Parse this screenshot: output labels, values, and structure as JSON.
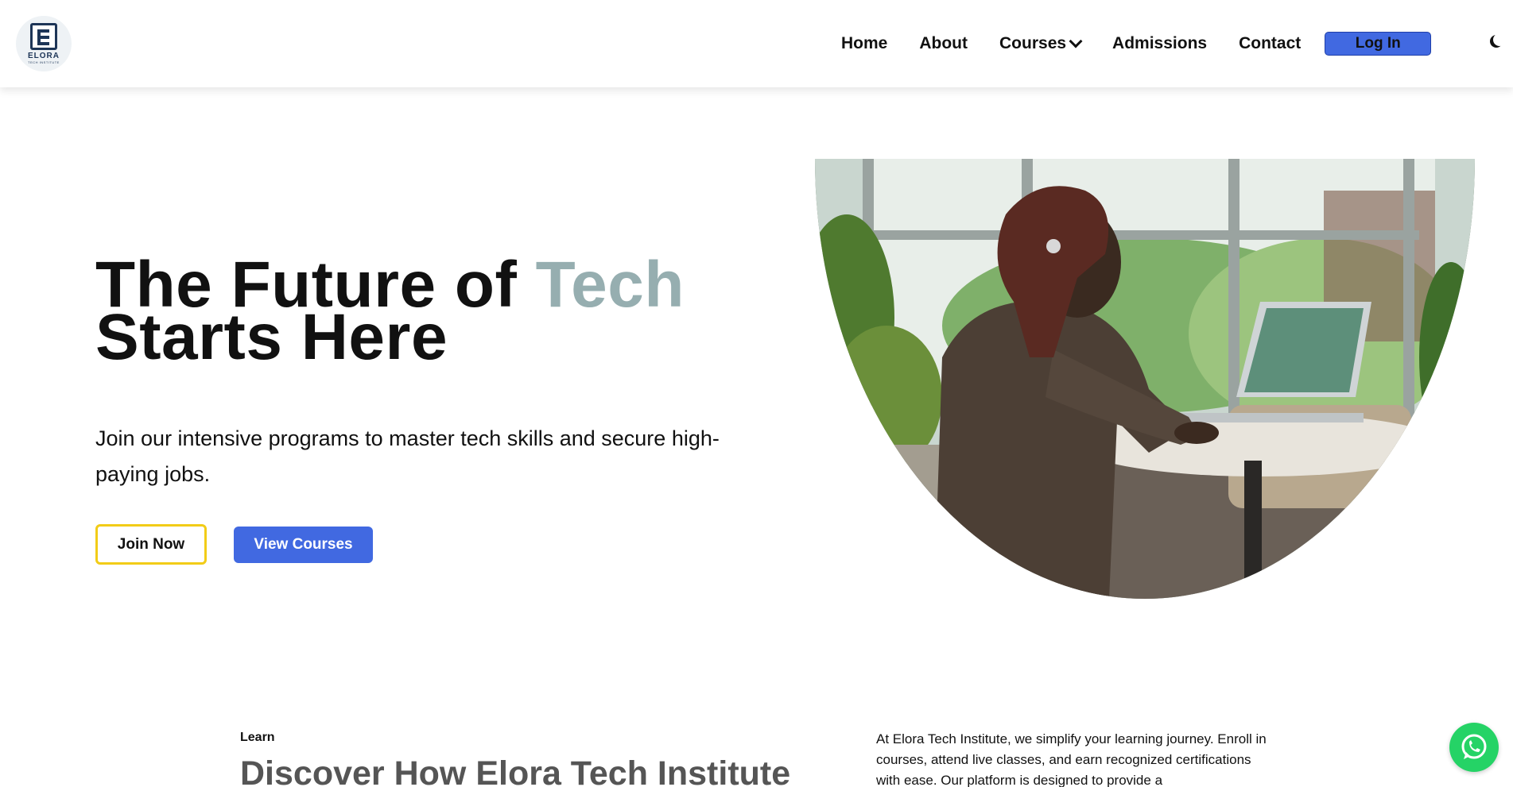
{
  "brand": {
    "logo_text": "ELORA",
    "logo_sub": "TECH INSTITUTE"
  },
  "nav": {
    "home": "Home",
    "about": "About",
    "courses": "Courses",
    "admissions": "Admissions",
    "contact": "Contact",
    "login": "Log In"
  },
  "hero": {
    "title_line1": "The Future of ",
    "title_accent": "Tech",
    "title_line2": "Starts Here",
    "subtitle": "Join our intensive programs to master tech skills and secure high-paying jobs.",
    "join_button": "Join Now",
    "courses_button": "View Courses"
  },
  "learn": {
    "label": "Learn",
    "title": "Discover How Elora Tech Institute",
    "description": "At Elora Tech Institute, we simplify your learning journey. Enroll in courses, attend live classes, and earn recognized certifications with ease. Our platform is designed to provide a"
  },
  "colors": {
    "primary": "#4169e1",
    "accent_text": "#96aeb0",
    "join_border": "#f2cc17",
    "whatsapp": "#25d366"
  },
  "icons": {
    "theme_toggle": "moon-icon",
    "courses_dropdown": "chevron-down-icon",
    "chat": "whatsapp-icon"
  }
}
